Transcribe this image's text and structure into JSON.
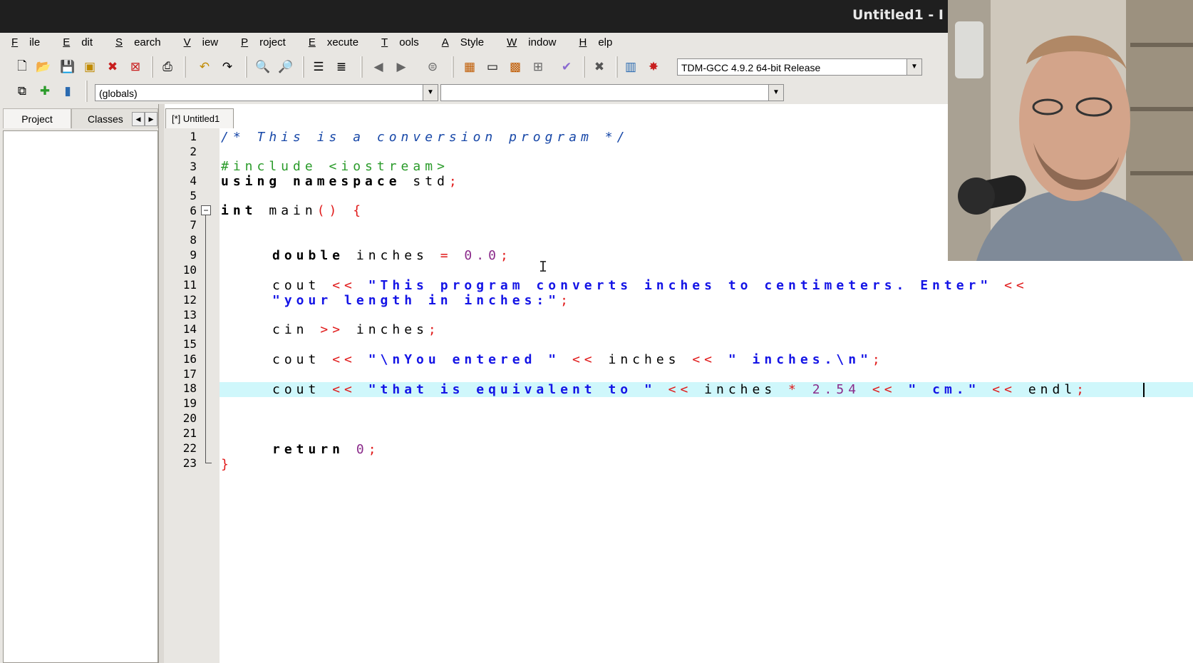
{
  "window": {
    "title": "Untitled1 - I"
  },
  "menu": [
    {
      "accel": "F",
      "rest": "ile"
    },
    {
      "accel": "E",
      "rest": "dit"
    },
    {
      "accel": "S",
      "rest": "earch"
    },
    {
      "accel": "V",
      "rest": "iew"
    },
    {
      "accel": "P",
      "rest": "roject"
    },
    {
      "accel": "E",
      "rest": "xecute"
    },
    {
      "accel": "T",
      "rest": "ools"
    },
    {
      "accel": "A",
      "rest": "Style"
    },
    {
      "accel": "W",
      "rest": "indow"
    },
    {
      "accel": "H",
      "rest": "elp"
    }
  ],
  "toolbar": {
    "compiler": "TDM-GCC 4.9.2 64-bit Release"
  },
  "scope": {
    "globals": "(globals)",
    "function": ""
  },
  "left_tabs": {
    "project": "Project",
    "classes": "Classes"
  },
  "editor": {
    "tab_label": "[*] Untitled1",
    "line_numbers": [
      "1",
      "2",
      "3",
      "4",
      "5",
      "6",
      "7",
      "8",
      "9",
      "10",
      "11",
      "12",
      "13",
      "14",
      "15",
      "16",
      "17",
      "18",
      "19",
      "20",
      "21",
      "22",
      "23"
    ],
    "code": {
      "l1": "/* This is a conversion program */",
      "l3": "#include <iostream>",
      "l4_kw": "using namespace",
      "l4_id": " std",
      "l4_op": ";",
      "l6_kw": "int",
      "l6_id": " main",
      "l6_op1": "()",
      "l6_op2": " {",
      "l9_kw": "double",
      "l9_id": " inches ",
      "l9_op": "=",
      "l9_num": " 0.0",
      "l9_semi": ";",
      "l11_id": "cout ",
      "l11_op": "<<",
      "l11_str": " \"This program converts inches to centimeters. Enter\" ",
      "l11_op2": "<<",
      "l12_str": "\"your length in inches:\"",
      "l12_op": ";",
      "l14_id": "cin ",
      "l14_op": ">>",
      "l14_id2": " inches",
      "l14_semi": ";",
      "l16_id": "cout ",
      "l16_op": "<<",
      "l16_str": " \"\\nYou entered \" ",
      "l16_op2": "<<",
      "l16_id2": " inches ",
      "l16_op3": "<<",
      "l16_str2": " \" inches.\\n\"",
      "l16_semi": ";",
      "l18_id": "cout ",
      "l18_op": "<<",
      "l18_str": " \"that is equivalent to \" ",
      "l18_op2": "<<",
      "l18_id2": " inches ",
      "l18_op3": "*",
      "l18_num": " 2.54 ",
      "l18_op4": "<<",
      "l18_str2": " \" cm.\" ",
      "l18_op5": "<<",
      "l18_id3": " endl",
      "l18_semi": ";",
      "l22_kw": "return",
      "l22_num": " 0",
      "l22_semi": ";",
      "l23_op": "}"
    }
  }
}
